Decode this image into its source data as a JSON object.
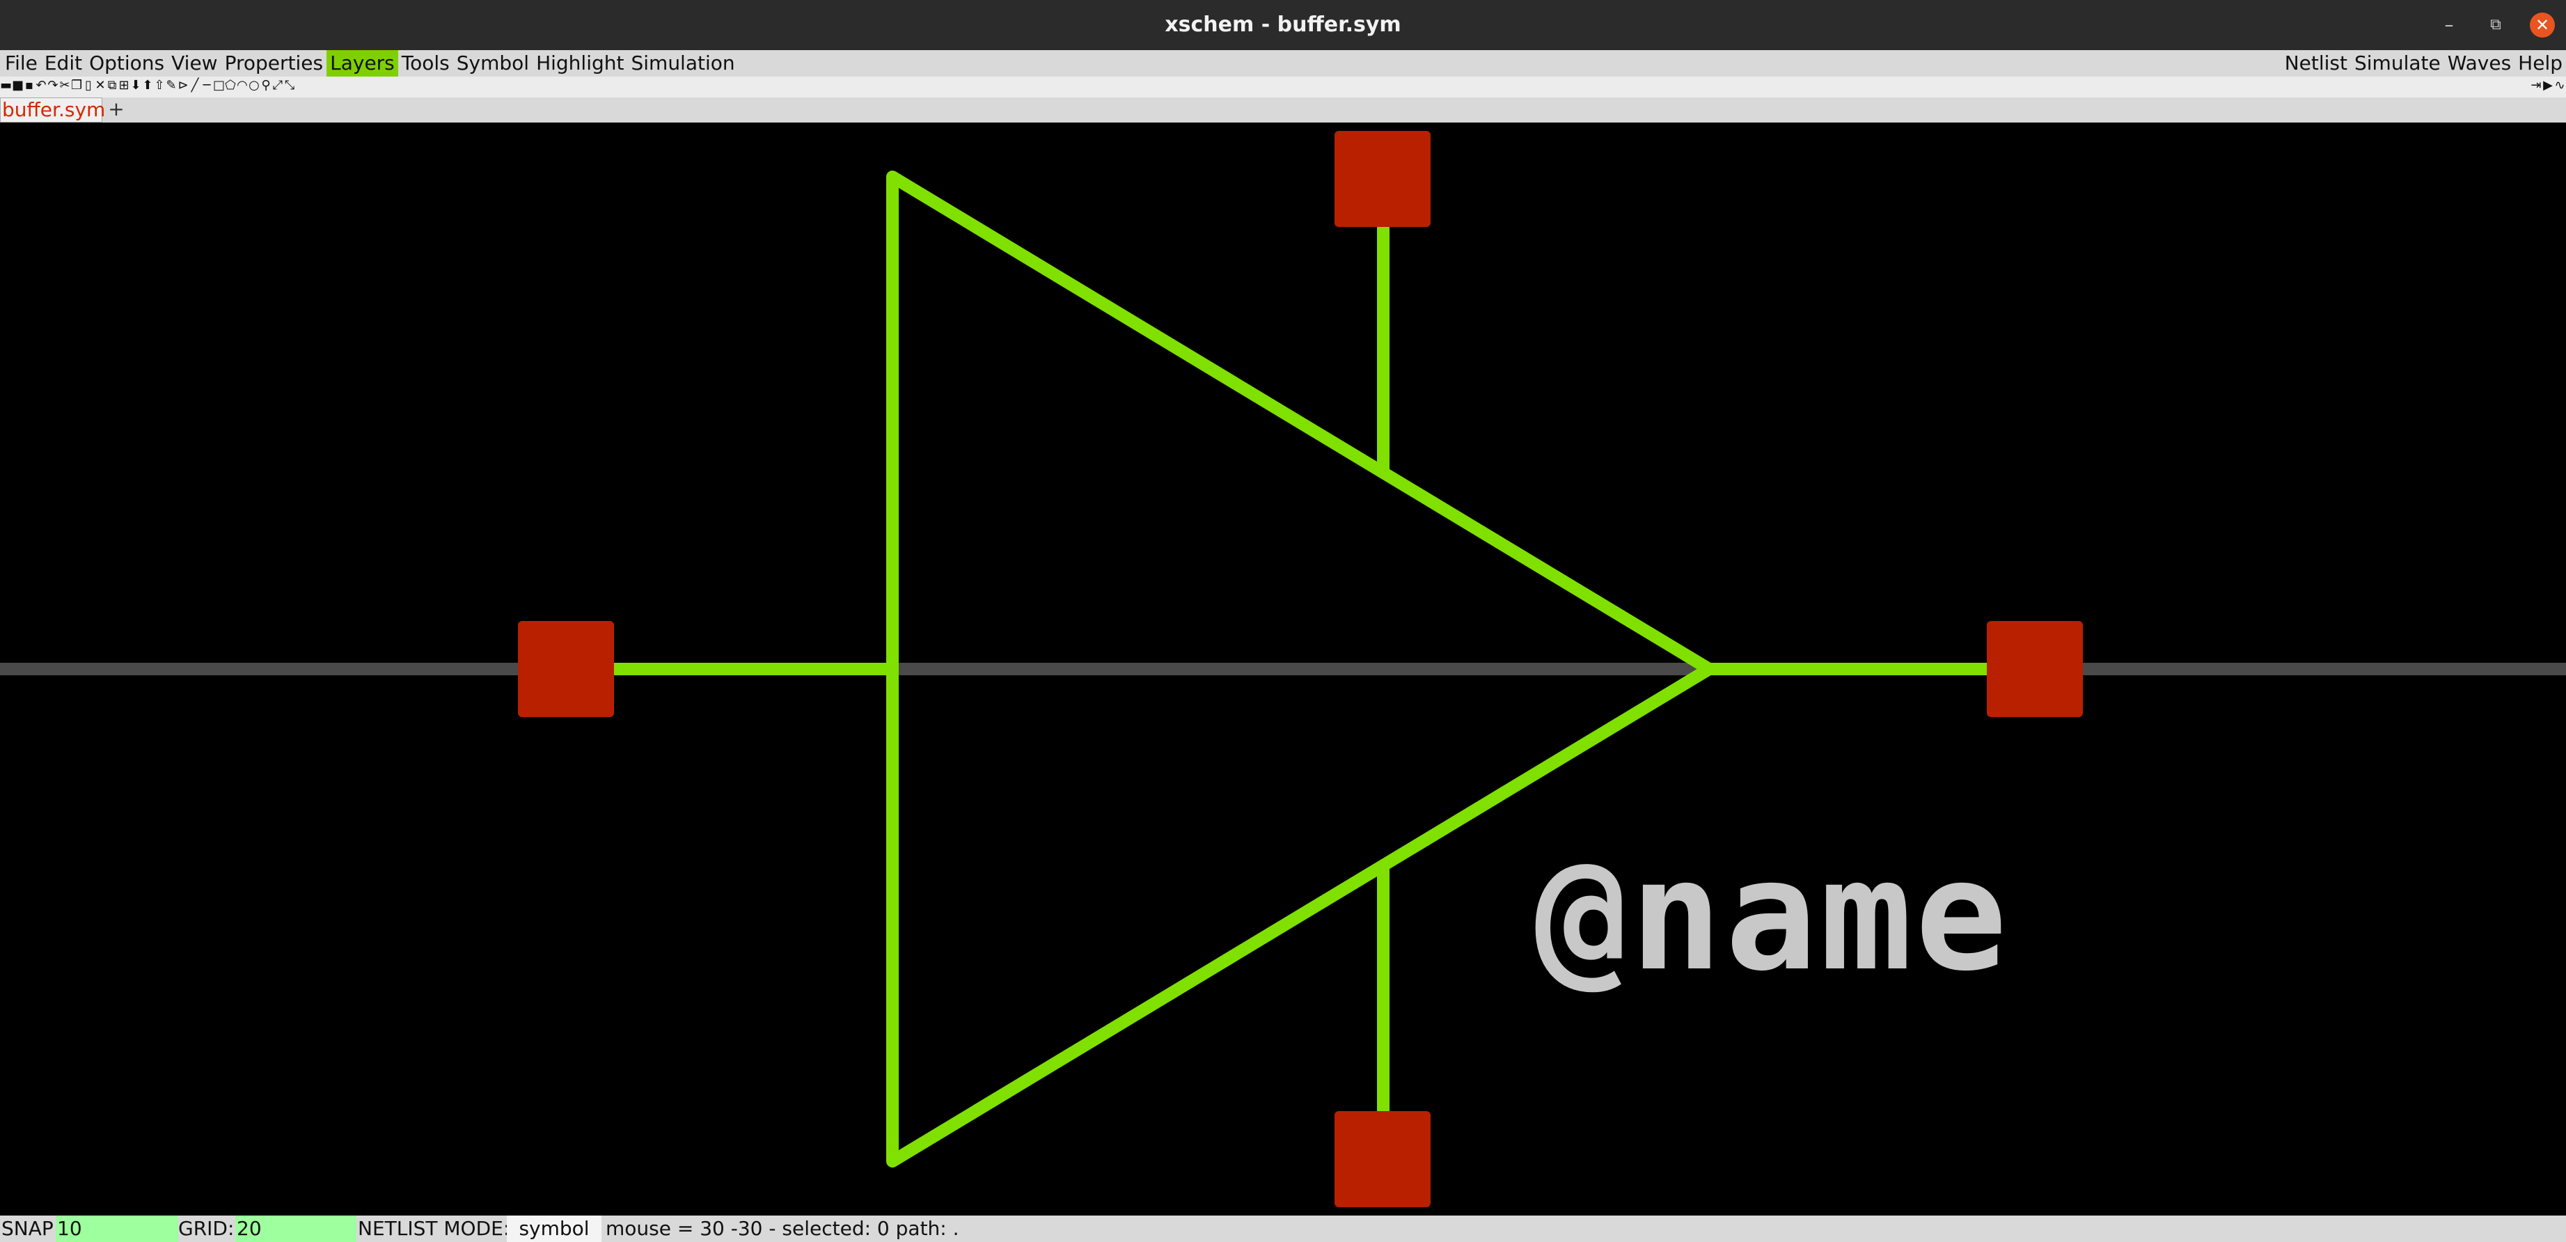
{
  "window": {
    "title": "xschem - buffer.sym",
    "controls": {
      "minimize": "–",
      "maximize": "⧉",
      "close": "✕"
    }
  },
  "menu": {
    "left": [
      "File",
      "Edit",
      "Options",
      "View",
      "Properties",
      "Layers",
      "Tools",
      "Symbol",
      "Highlight",
      "Simulation"
    ],
    "active": "Layers",
    "right": [
      "Netlist",
      "Simulate",
      "Waves",
      "Help"
    ]
  },
  "toolbar": {
    "icons": [
      "open-icon",
      "save-icon",
      "save-as-icon",
      "undo-icon",
      "redo-icon",
      "cut-icon",
      "copy-icon",
      "paste-icon",
      "delete-icon",
      "duplicate-icon",
      "move-icon",
      "push-icon",
      "pop-icon",
      "up-icon",
      "select-icon",
      "label-icon",
      "wire-icon",
      "line-icon",
      "rect-icon",
      "polygon-icon",
      "arc-icon",
      "circle-icon",
      "zoom-icon",
      "zoom-fit-icon",
      "zoom-full-icon"
    ],
    "right_icons": [
      "netlist-icon",
      "simulate-icon",
      "waves-icon"
    ]
  },
  "tabs": {
    "items": [
      {
        "label": "buffer.sym"
      }
    ],
    "add_label": "+"
  },
  "canvas": {
    "background": "#000000",
    "symbol_color": "#80e000",
    "pin_color": "#b92000",
    "axis_color": "#4a4a4a",
    "name_label": "@name",
    "name_label_color": "#c8c8c8"
  },
  "status": {
    "snap_label": "SNAP:",
    "snap_value": "10",
    "grid_label": "GRID:",
    "grid_value": "20",
    "netlist_mode_label": "NETLIST MODE:",
    "netlist_mode_value": "symbol",
    "info": "mouse = 30 -30 - selected: 0 path: ."
  }
}
